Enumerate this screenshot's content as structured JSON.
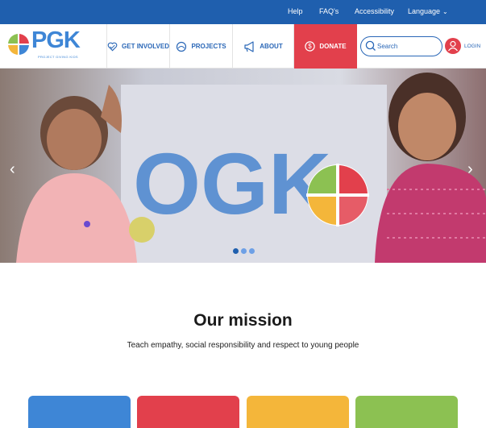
{
  "topbar": {
    "help": "Help",
    "faqs": "FAQ's",
    "accessibility": "Accessibility",
    "language": "Language"
  },
  "logo": {
    "text": "PGK",
    "tagline": "PROJECT GIVING KIDS"
  },
  "nav": {
    "get_involved": "GET INVOLVED",
    "projects": "PROJECTS",
    "about": "ABOUT",
    "donate": "DONATE",
    "search_placeholder": "Search",
    "login": "LOGIN"
  },
  "hero": {
    "prev_icon": "chevron-left-icon",
    "next_icon": "chevron-right-icon",
    "slides": 3,
    "active_slide": 1
  },
  "mission": {
    "title": "Our mission",
    "subtitle": "Teach empathy, social responsibility and respect to young people"
  },
  "colors": {
    "brand_blue": "#1f5fae",
    "accent_blue": "#2a67b7",
    "donate_red": "#e2404c",
    "card_blue": "#3e86d6",
    "card_red": "#e2404c",
    "card_yellow": "#f4b63a",
    "card_green": "#8cc152"
  }
}
